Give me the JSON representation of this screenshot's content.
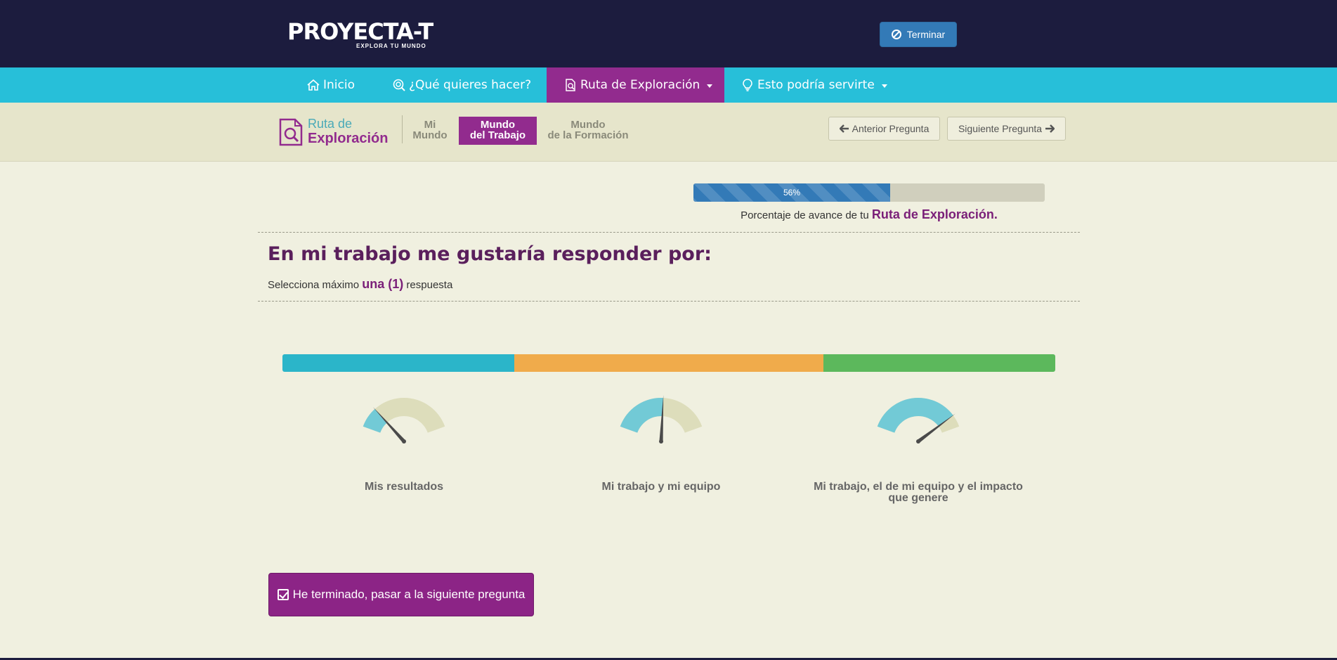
{
  "header": {
    "logo_text": "PROYECTA-T",
    "logo_tagline": "EXPLORA TU MUNDO",
    "terminar_label": "Terminar"
  },
  "nav": {
    "items": [
      {
        "label": "Inicio",
        "icon": "home-icon"
      },
      {
        "label": "¿Qué quieres hacer?",
        "icon": "search-target-icon"
      },
      {
        "label": "Ruta de Exploración",
        "icon": "route-search-icon",
        "active": true,
        "dropdown": true
      },
      {
        "label": "Esto podría servirte",
        "icon": "lightbulb-icon",
        "dropdown": true
      }
    ]
  },
  "subnav": {
    "route_title_1": "Ruta de",
    "route_title_2": "Exploración",
    "tabs": [
      {
        "line1": "Mi",
        "line2": "Mundo"
      },
      {
        "line1": "Mundo",
        "line2": "del Trabajo",
        "active": true
      },
      {
        "line1": "Mundo",
        "line2": "de la Formación"
      }
    ],
    "prev_label": "Anterior Pregunta",
    "next_label": "Siguiente Pregunta"
  },
  "progress": {
    "percent": 56,
    "label": "56%",
    "caption_prefix": "Porcentaje de avance de tu",
    "caption_highlight": "Ruta de Exploración."
  },
  "question": {
    "title": "En mi trabajo me gustaría responder por:",
    "instruction_prefix": "Selecciona máximo",
    "instruction_highlight": "una (1)",
    "instruction_suffix": "respuesta"
  },
  "colors": {
    "segment_1": "#2bb5c9",
    "segment_2": "#f0ab4b",
    "segment_3": "#5cb85c",
    "gauge_fill": "#72cad6",
    "gauge_track": "#ddddbb",
    "needle": "#4a4a4a",
    "accent": "#922b8e"
  },
  "colorbar_segments": [
    0.3,
    0.4,
    0.3
  ],
  "options": [
    {
      "label": "Mis resultados",
      "level": 0.2
    },
    {
      "label": "Mi trabajo y mi equipo",
      "level": 0.52
    },
    {
      "label": "Mi trabajo, el de mi equipo y el impacto que genere",
      "level": 0.88
    }
  ],
  "submit_label": "He terminado, pasar a la siguiente pregunta"
}
